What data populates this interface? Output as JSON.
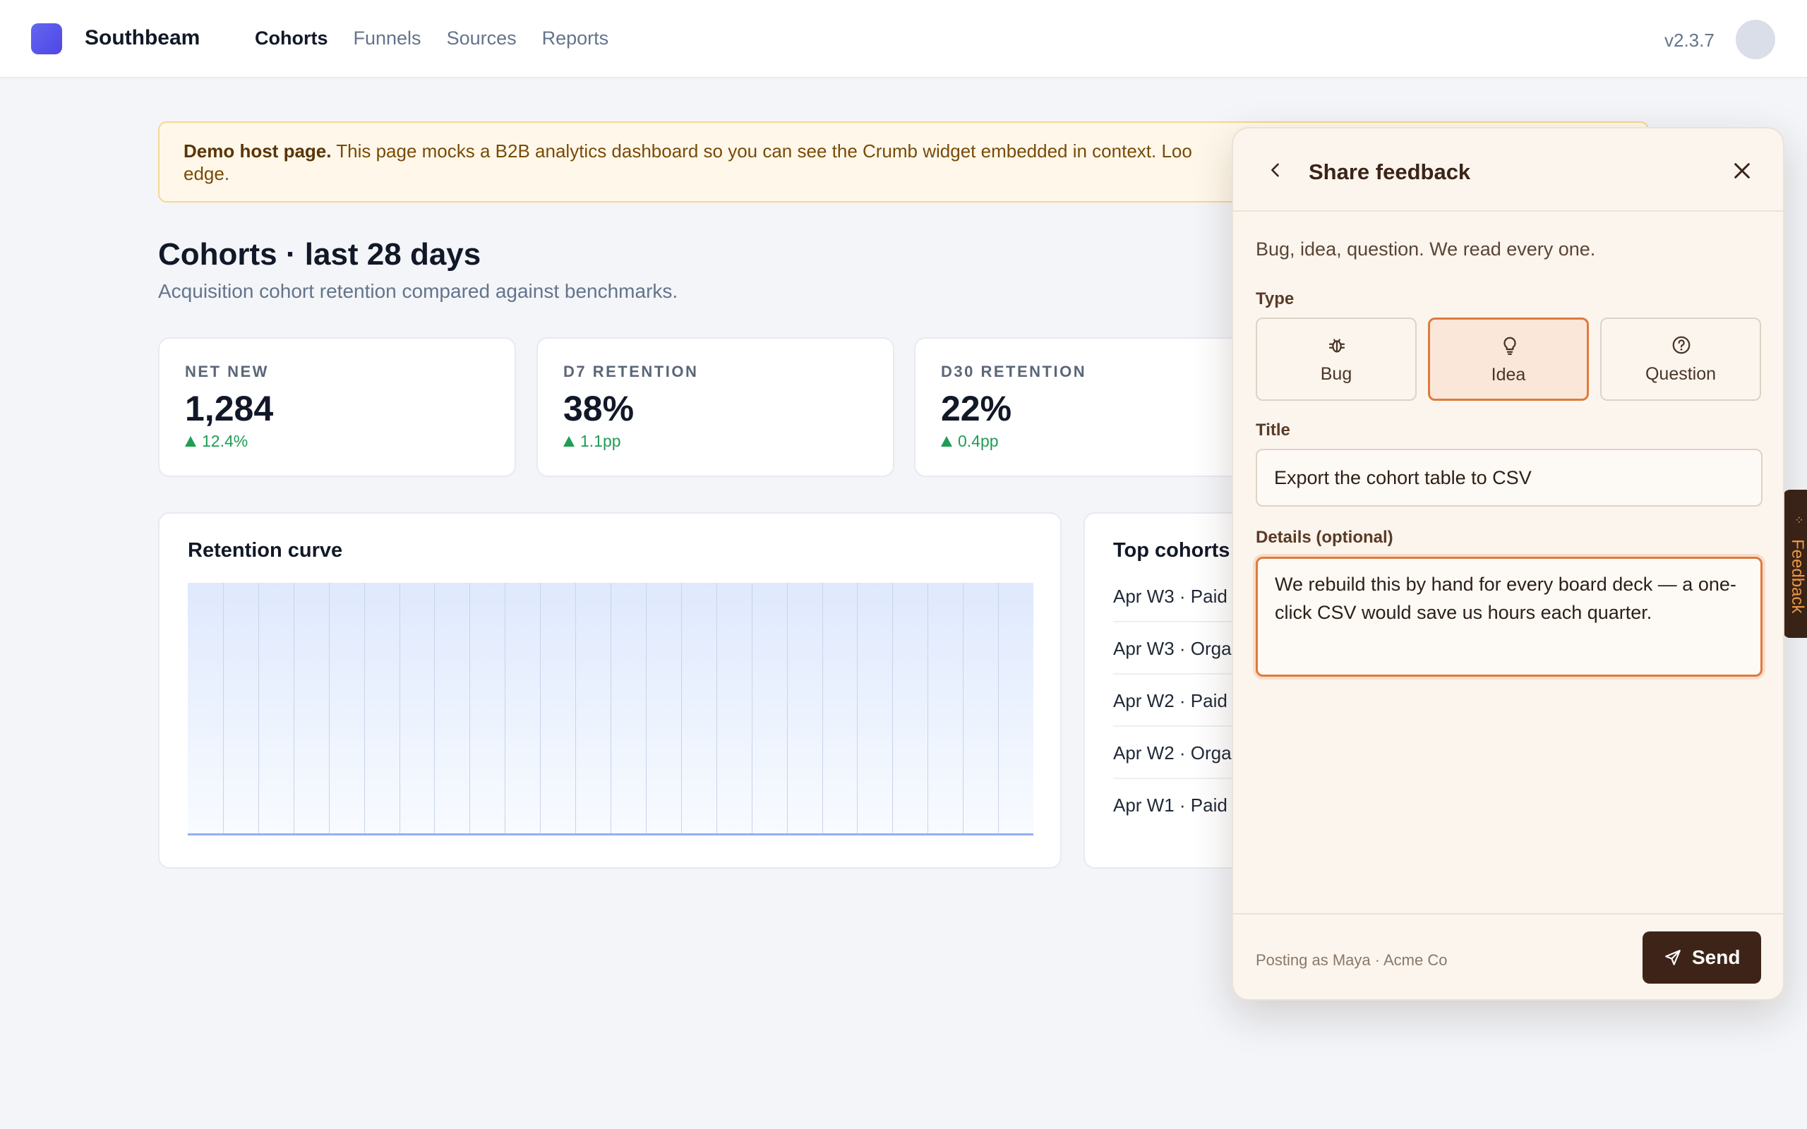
{
  "app": {
    "brand": "Southbeam",
    "version": "v2.3.7",
    "brand_color": "#5b5cf0"
  },
  "nav": {
    "items": [
      {
        "label": "Cohorts",
        "active": true
      },
      {
        "label": "Funnels",
        "active": false
      },
      {
        "label": "Sources",
        "active": false
      },
      {
        "label": "Reports",
        "active": false
      }
    ]
  },
  "banner": {
    "bold": "Demo host page.",
    "text": " This page mocks a B2B analytics dashboard so you can see the Crumb widget embedded in context. Loo",
    "text_line2": "edge."
  },
  "page": {
    "title": "Cohorts · last 28 days",
    "subtitle": "Acquisition cohort retention compared against benchmarks."
  },
  "stats": [
    {
      "label": "NET NEW",
      "value": "1,284",
      "delta": "12.4%"
    },
    {
      "label": "D7 RETENTION",
      "value": "38%",
      "delta": "1.1pp"
    },
    {
      "label": "D30 RETENTION",
      "value": "22%",
      "delta": "0.4pp"
    }
  ],
  "retention_panel": {
    "title": "Retention curve"
  },
  "cohorts_panel": {
    "title": "Top cohorts",
    "rows": [
      "Apr W3 · Paid",
      "Apr W3 · Orga",
      "Apr W2 · Paid",
      "Apr W2 · Orga",
      "Apr W1 · Paid"
    ]
  },
  "feedback_tab": {
    "label": "Feedback"
  },
  "widget": {
    "title": "Share feedback",
    "intro": "Bug, idea, question. We read every one.",
    "type_label": "Type",
    "types": [
      {
        "label": "Bug",
        "icon": "bug-icon",
        "selected": false
      },
      {
        "label": "Idea",
        "icon": "lightbulb-icon",
        "selected": true
      },
      {
        "label": "Question",
        "icon": "question-circle-icon",
        "selected": false
      }
    ],
    "title_label": "Title",
    "title_value": "Export the cohort table to CSV",
    "details_label": "Details (optional)",
    "details_value": "We rebuild this by hand for every board deck — a one-click CSV would save us hours each quarter.",
    "posting_as": "Posting as Maya · Acme Co",
    "send_label": "Send",
    "accent_color": "#e07a3c",
    "send_color": "#3e2418"
  }
}
